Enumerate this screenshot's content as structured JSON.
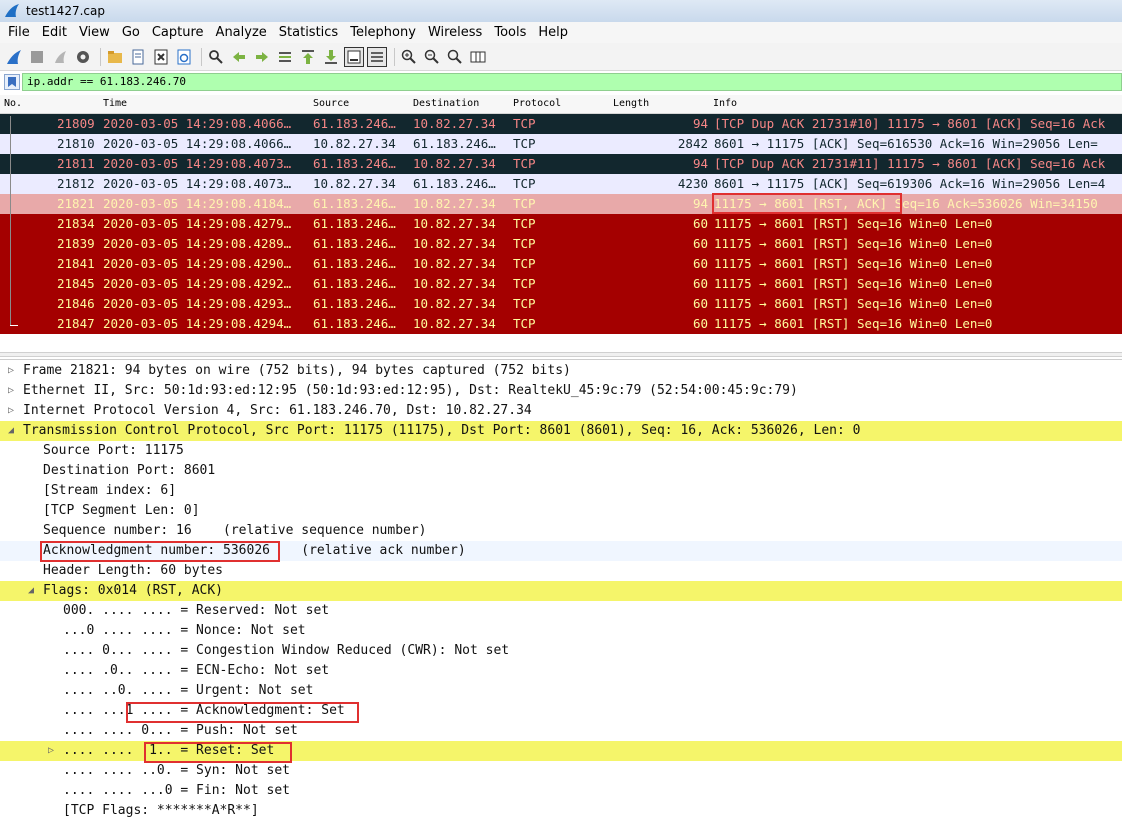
{
  "window": {
    "title": "test1427.cap"
  },
  "menu": [
    "File",
    "Edit",
    "View",
    "Go",
    "Capture",
    "Analyze",
    "Statistics",
    "Telephony",
    "Wireless",
    "Tools",
    "Help"
  ],
  "filter": {
    "value": "ip.addr == 61.183.246.70"
  },
  "columns": [
    "No.",
    "Time",
    "Source",
    "Destination",
    "Protocol",
    "Length",
    "Info"
  ],
  "packets": [
    {
      "no": "21809",
      "time": "2020-03-05 14:29:08.4066…",
      "src": "61.183.246…",
      "dst": "10.82.27.34",
      "proto": "TCP",
      "len": "94",
      "info": "[TCP Dup ACK 21731#10] 11175 → 8601 [ACK] Seq=16 Ack"
    },
    {
      "no": "21810",
      "time": "2020-03-05 14:29:08.4066…",
      "src": "10.82.27.34",
      "dst": "61.183.246…",
      "proto": "TCP",
      "len": "2842",
      "info": "8601 → 11175 [ACK] Seq=616530 Ack=16 Win=29056 Len="
    },
    {
      "no": "21811",
      "time": "2020-03-05 14:29:08.4073…",
      "src": "61.183.246…",
      "dst": "10.82.27.34",
      "proto": "TCP",
      "len": "94",
      "info": "[TCP Dup ACK 21731#11] 11175 → 8601 [ACK] Seq=16 Ack"
    },
    {
      "no": "21812",
      "time": "2020-03-05 14:29:08.4073…",
      "src": "10.82.27.34",
      "dst": "61.183.246…",
      "proto": "TCP",
      "len": "4230",
      "info": "8601 → 11175 [ACK] Seq=619306 Ack=16 Win=29056 Len=4"
    },
    {
      "no": "21821",
      "time": "2020-03-05 14:29:08.4184…",
      "src": "61.183.246…",
      "dst": "10.82.27.34",
      "proto": "TCP",
      "len": "94",
      "info": "11175 → 8601 [RST, ACK] Seq=16 Ack=536026 Win=34150"
    },
    {
      "no": "21834",
      "time": "2020-03-05 14:29:08.4279…",
      "src": "61.183.246…",
      "dst": "10.82.27.34",
      "proto": "TCP",
      "len": "60",
      "info": "11175 → 8601 [RST] Seq=16 Win=0 Len=0"
    },
    {
      "no": "21839",
      "time": "2020-03-05 14:29:08.4289…",
      "src": "61.183.246…",
      "dst": "10.82.27.34",
      "proto": "TCP",
      "len": "60",
      "info": "11175 → 8601 [RST] Seq=16 Win=0 Len=0"
    },
    {
      "no": "21841",
      "time": "2020-03-05 14:29:08.4290…",
      "src": "61.183.246…",
      "dst": "10.82.27.34",
      "proto": "TCP",
      "len": "60",
      "info": "11175 → 8601 [RST] Seq=16 Win=0 Len=0"
    },
    {
      "no": "21845",
      "time": "2020-03-05 14:29:08.4292…",
      "src": "61.183.246…",
      "dst": "10.82.27.34",
      "proto": "TCP",
      "len": "60",
      "info": "11175 → 8601 [RST] Seq=16 Win=0 Len=0"
    },
    {
      "no": "21846",
      "time": "2020-03-05 14:29:08.4293…",
      "src": "61.183.246…",
      "dst": "10.82.27.34",
      "proto": "TCP",
      "len": "60",
      "info": "11175 → 8601 [RST] Seq=16 Win=0 Len=0"
    },
    {
      "no": "21847",
      "time": "2020-03-05 14:29:08.4294…",
      "src": "61.183.246…",
      "dst": "10.82.27.34",
      "proto": "TCP",
      "len": "60",
      "info": "11175 → 8601 [RST] Seq=16 Win=0 Len=0"
    }
  ],
  "details": [
    "Frame 21821: 94 bytes on wire (752 bits), 94 bytes captured (752 bits)",
    "Ethernet II, Src: 50:1d:93:ed:12:95 (50:1d:93:ed:12:95), Dst: RealtekU_45:9c:79 (52:54:00:45:9c:79)",
    "Internet Protocol Version 4, Src: 61.183.246.70, Dst: 10.82.27.34",
    "Transmission Control Protocol, Src Port: 11175 (11175), Dst Port: 8601 (8601), Seq: 16, Ack: 536026, Len: 0",
    "Source Port: 11175",
    "Destination Port: 8601",
    "[Stream index: 6]",
    "[TCP Segment Len: 0]",
    "Sequence number: 16    (relative sequence number)",
    "Acknowledgment number: 536026    (relative ack number)",
    "Header Length: 60 bytes",
    "Flags: 0x014 (RST, ACK)",
    "000. .... .... = Reserved: Not set",
    "...0 .... .... = Nonce: Not set",
    ".... 0... .... = Congestion Window Reduced (CWR): Not set",
    ".... .0.. .... = ECN-Echo: Not set",
    ".... ..0. .... = Urgent: Not set",
    ".... ...1 .... = Acknowledgment: Set",
    ".... .... 0... = Push: Not set",
    ".... .... .1.. = Reset: Set",
    ".... .... ..0. = Syn: Not set",
    ".... .... ...0 = Fin: Not set",
    "[TCP Flags: *******A*R**]"
  ]
}
